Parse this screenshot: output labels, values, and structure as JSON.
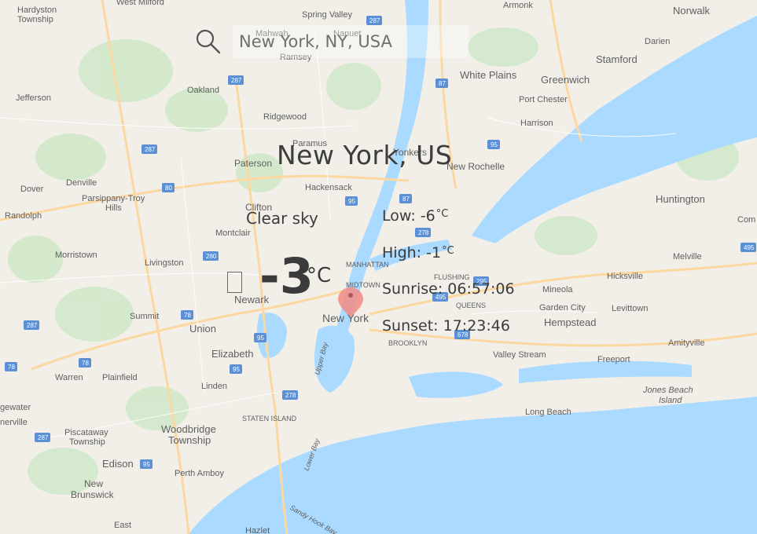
{
  "search": {
    "value": "New York, NY, USA",
    "placeholder": "New York, NY, USA"
  },
  "weather": {
    "city": "New York, US",
    "condition": "Clear sky",
    "temperature": "-3",
    "temperature_unit": "°C",
    "low_label": "Low: -6",
    "low_unit": "°C",
    "high_label": "High: -1",
    "high_unit": "°C",
    "sunrise": "Sunrise: 06:57:06",
    "sunset": "Sunset: 17:23:46",
    "condition_icon": "weather-condition-icon"
  },
  "map": {
    "places": [
      "Hardyston Township",
      "West Milford",
      "Spring Valley",
      "Nanuet",
      "Armonk",
      "Norwalk",
      "Mahwah",
      "Ramsey",
      "Darien",
      "Stamford",
      "White Plains",
      "Greenwich",
      "Port Chester",
      "Jefferson",
      "Oakland",
      "Ridgewood",
      "Harrison",
      "Paramus",
      "Yonkers",
      "New Rochelle",
      "Paterson",
      "Denville",
      "Dover",
      "Parsippany-Troy Hills",
      "Hackensack",
      "Huntington",
      "Randolph",
      "Clifton",
      "Montclair",
      "Morristown",
      "Livingston",
      "MANHATTAN",
      "Melville",
      "Hicksville",
      "Newark",
      "MIDTOWN",
      "FLUSHING",
      "Mineola",
      "QUEENS",
      "Garden City",
      "Levittown",
      "Summit",
      "New York",
      "Hempstead",
      "Union",
      "Elizabeth",
      "BROOKLYN",
      "Valley Stream",
      "Freeport",
      "Amityville",
      "Warren",
      "Plainfield",
      "Linden",
      "Jones Beach Island",
      "Long Beach",
      "STATEN ISLAND",
      "Woodbridge Township",
      "Piscataway Township",
      "Edison",
      "Perth Amboy",
      "New Brunswick",
      "East Brunswick",
      "Hazlet",
      "Upper Bay",
      "Lower Bay",
      "Sandy Hook Bay",
      "Com",
      "gewater",
      "nerville"
    ],
    "colors": {
      "land": "#f2efe9",
      "water": "#aadaff",
      "park": "#c8e6c1",
      "highway": "#fcd8a0",
      "marker": "#e57373"
    }
  }
}
